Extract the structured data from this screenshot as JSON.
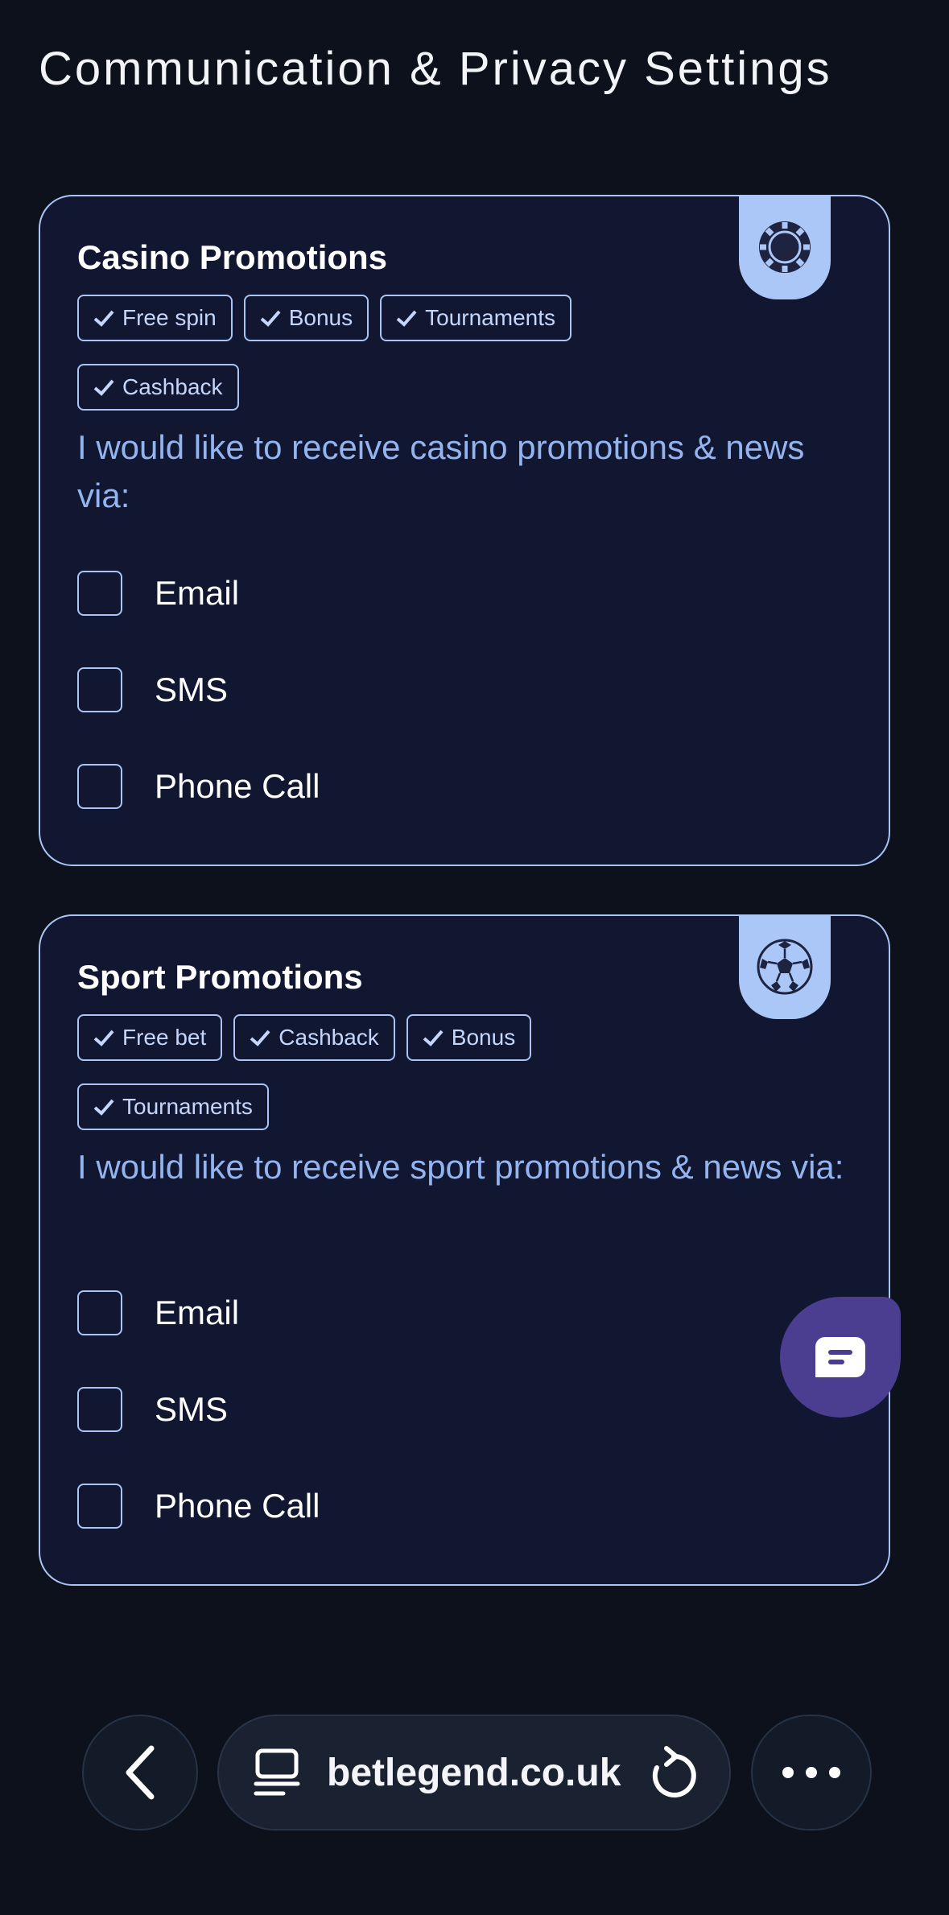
{
  "page": {
    "title": "Communication & Privacy Settings"
  },
  "casino": {
    "icon": "casino-chip-icon",
    "title": "Casino Promotions",
    "tags": [
      "Free spin",
      "Bonus",
      "Tournaments",
      "Cashback"
    ],
    "description": "I would like to receive casino promotions & news via:",
    "options": [
      {
        "label": "Email",
        "checked": false
      },
      {
        "label": "SMS",
        "checked": false
      },
      {
        "label": "Phone Call",
        "checked": false
      }
    ]
  },
  "sport": {
    "icon": "soccer-ball-icon",
    "title": "Sport Promotions",
    "tags": [
      "Free bet",
      "Cashback",
      "Bonus",
      "Tournaments"
    ],
    "description": "I would like to receive sport promotions & news via:",
    "options": [
      {
        "label": "Email",
        "checked": false
      },
      {
        "label": "SMS",
        "checked": false
      },
      {
        "label": "Phone Call",
        "checked": false
      }
    ]
  },
  "chat": {
    "icon": "chat-bubble-icon"
  },
  "browser": {
    "back_icon": "chevron-left-icon",
    "site_icon": "site-info-icon",
    "url": "betlegend.co.uk",
    "reload_icon": "reload-icon",
    "more_icon": "more-dots-icon"
  },
  "colors": {
    "background": "#0c111b",
    "card_bg": "#111631",
    "accent": "#a9c4f5",
    "description": "#93b4ef",
    "chat_button": "#4b3d8f"
  }
}
